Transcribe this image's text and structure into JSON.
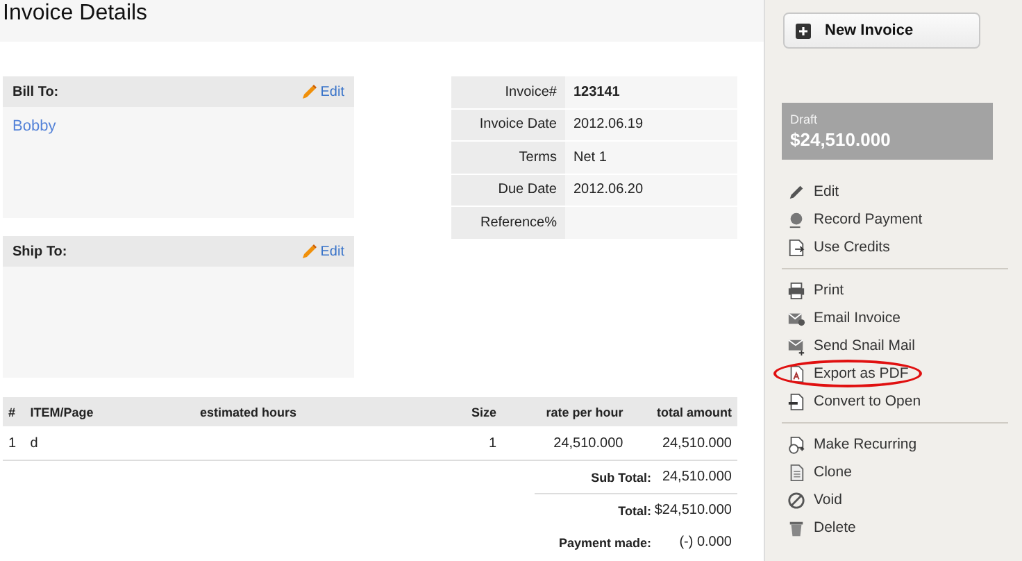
{
  "page": {
    "title": "Invoice Details"
  },
  "addresses": [
    {
      "label": "Bill To:",
      "edit": "Edit",
      "name": "Bobby"
    },
    {
      "label": "Ship To:",
      "edit": "Edit"
    }
  ],
  "invoice_info": [
    {
      "label": "Invoice#",
      "value": "123141",
      "bold": true
    },
    {
      "label": "Invoice Date",
      "value": "2012.06.19",
      "bold": false
    },
    {
      "label": "Terms",
      "value": "Net 1",
      "bold": false
    },
    {
      "label": "Due Date",
      "value": "2012.06.20",
      "bold": false
    },
    {
      "label": "Reference%"
    }
  ],
  "items_table": {
    "columns": [
      "#",
      "ITEM/Page",
      "estimated hours",
      "Size",
      "rate per hour",
      "total amount"
    ],
    "rows": [
      [
        "1",
        "d",
        "",
        "1",
        "24,510.000",
        "24,510.000"
      ]
    ]
  },
  "totals": [
    {
      "label": "Sub Total:",
      "value": "24,510.000"
    },
    {
      "label": "Total:",
      "value": "$24,510.000"
    },
    {
      "label": "Payment made:",
      "value": "(-) 0.000"
    }
  ],
  "sidebar": {
    "new_button": "New Invoice",
    "status": "Draft",
    "amount": "$24,510.000",
    "groups": [
      [
        {
          "label": "Edit",
          "highlighted": false
        },
        {
          "label": "Record Payment",
          "highlighted": false
        },
        {
          "label": "Use Credits",
          "highlighted": false
        }
      ],
      [
        {
          "label": "Print",
          "highlighted": false
        },
        {
          "label": "Email Invoice",
          "highlighted": false
        },
        {
          "label": "Send Snail Mail",
          "highlighted": false
        },
        {
          "label": "Export as PDF",
          "highlighted": true
        },
        {
          "label": "Convert to Open",
          "highlighted": false
        }
      ],
      [
        {
          "label": "Make Recurring",
          "highlighted": false
        },
        {
          "label": "Clone",
          "highlighted": false
        },
        {
          "label": "Void",
          "highlighted": false
        },
        {
          "label": "Delete",
          "highlighted": false
        }
      ]
    ]
  }
}
